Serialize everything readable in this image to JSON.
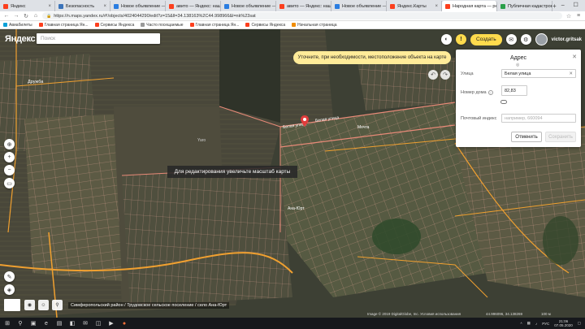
{
  "browser": {
    "tabs": [
      {
        "label": "Яндекс",
        "color": "#fc3f1d",
        "active": false
      },
      {
        "label": "Безопасность",
        "color": "#3b73b9",
        "active": false
      },
      {
        "label": "Новое объявление —",
        "color": "#2a7de1",
        "active": false
      },
      {
        "label": "авито — Яндекс: нашл",
        "color": "#fc3f1d",
        "active": false
      },
      {
        "label": "Новое объявление —",
        "color": "#2a7de1",
        "active": false
      },
      {
        "label": "авито — Яндекс: нашл",
        "color": "#fc3f1d",
        "active": false
      },
      {
        "label": "Новое объявление —",
        "color": "#2a7de1",
        "active": false
      },
      {
        "label": "Яндекс.Карты",
        "color": "#fc3f1d",
        "active": false
      },
      {
        "label": "Народная карта — ред",
        "color": "#fc3f1d",
        "active": true
      },
      {
        "label": "Публичная кадастрова",
        "color": "#2ba04a",
        "active": false
      }
    ],
    "new_tab": "+",
    "url": "https://n.maps.yandex.ru/#!/objects/4024044290/edit?z=15&ll=34.138163%2C44.998966&l=nk%23sat",
    "bookmarks": [
      {
        "label": "Авиабилеты",
        "color": "#0aa0d8"
      },
      {
        "label": "Главная страница Ян...",
        "color": "#fc3f1d"
      },
      {
        "label": "Сервисы Яндекса",
        "color": "#fc3f1d"
      },
      {
        "label": "Часто посещаемые",
        "color": "#999999"
      },
      {
        "label": "Главная страница Ян...",
        "color": "#fc3f1d"
      },
      {
        "label": "Сервисы Яндекса",
        "color": "#fc3f1d"
      },
      {
        "label": "Начальная страница",
        "color": "#f08c00"
      }
    ]
  },
  "app": {
    "logo": "Яндекс",
    "search_placeholder": "Поиск",
    "create_label": "Создать",
    "username": "victor.gritsak",
    "hint": "Уточните, при необходимости, местоположение объекта на карте",
    "zoom_message": "Для редактирования увеличьте масштаб карты",
    "region": "Симферопольский район / Трудовское сельское поселение / село Ана-Юрт",
    "copyright": "Image © 2019 DigitalGlobe, Inc. Условия использования",
    "coords": "44.996096, 34.138269",
    "scale": "100 м"
  },
  "panel": {
    "title": "Адрес",
    "street_label": "Улица",
    "street_value": "Белая улица",
    "house_label": "Номер дома",
    "house_value": "82,83",
    "postal_label": "Почтовый индекс",
    "postal_placeholder": "например, 660094",
    "cancel_label": "Отменить",
    "save_label": "Сохранить"
  },
  "map_labels": {
    "street1": "Белая улица",
    "street2": "Белая улица",
    "street3": "Мечта",
    "village": "Ана-Юрт",
    "village2": "Дружба",
    "field": "Yaro"
  },
  "taskbar": {
    "time": "21:06",
    "date": "07.05.2020",
    "lang": "РУС"
  },
  "colors": {
    "accent": "#ffdb4d",
    "parcel": "#e8a898",
    "road": "#f0a030",
    "marker": "#e03c3c"
  }
}
